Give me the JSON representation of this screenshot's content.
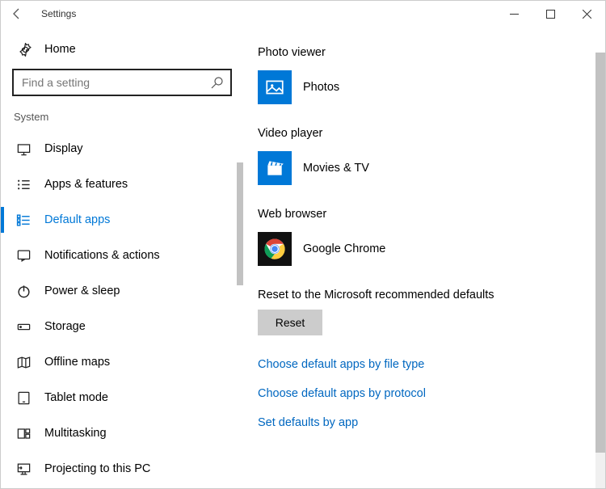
{
  "window": {
    "title": "Settings"
  },
  "sidebar": {
    "home_label": "Home",
    "search_placeholder": "Find a setting",
    "group_label": "System",
    "items": [
      {
        "label": "Display"
      },
      {
        "label": "Apps & features"
      },
      {
        "label": "Default apps",
        "active": true
      },
      {
        "label": "Notifications & actions"
      },
      {
        "label": "Power & sleep"
      },
      {
        "label": "Storage"
      },
      {
        "label": "Offline maps"
      },
      {
        "label": "Tablet mode"
      },
      {
        "label": "Multitasking"
      },
      {
        "label": "Projecting to this PC"
      }
    ]
  },
  "main": {
    "photo_viewer": {
      "heading": "Photo viewer",
      "app": "Photos"
    },
    "video_player": {
      "heading": "Video player",
      "app": "Movies & TV"
    },
    "web_browser": {
      "heading": "Web browser",
      "app": "Google Chrome"
    },
    "reset_heading": "Reset to the Microsoft recommended defaults",
    "reset_button": "Reset",
    "links": {
      "by_file_type": "Choose default apps by file type",
      "by_protocol": "Choose default apps by protocol",
      "by_app": "Set defaults by app"
    }
  }
}
